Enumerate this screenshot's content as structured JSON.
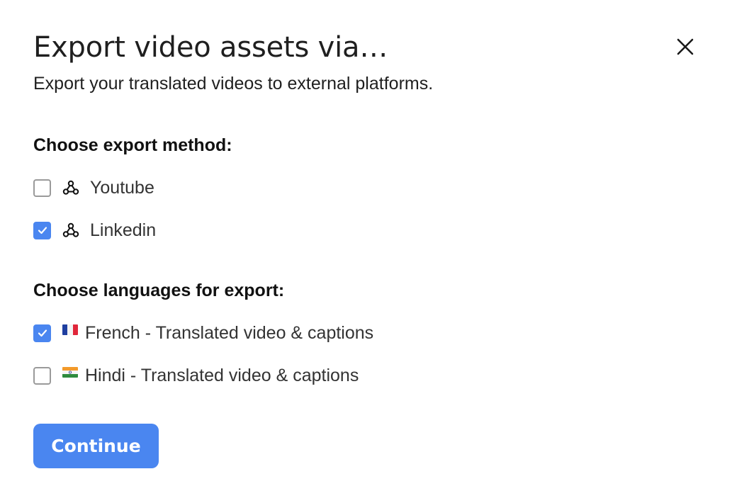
{
  "dialog": {
    "title": "Export video assets via…",
    "subtitle": "Export your translated videos to external platforms.",
    "close_icon": "close-icon"
  },
  "export_methods": {
    "heading": "Choose export method:",
    "items": [
      {
        "label": "Youtube",
        "checked": false,
        "icon": "webhook-icon"
      },
      {
        "label": "Linkedin",
        "checked": true,
        "icon": "webhook-icon"
      }
    ]
  },
  "languages": {
    "heading": "Choose languages for export:",
    "items": [
      {
        "label": "French - Translated video & captions",
        "checked": true,
        "flag": "flag-france-icon"
      },
      {
        "label": "Hindi - Translated video & captions",
        "checked": false,
        "flag": "flag-india-icon"
      }
    ]
  },
  "actions": {
    "continue_label": "Continue"
  },
  "colors": {
    "accent": "#4a86f0",
    "checkbox_border": "#9a9a9a",
    "text": "#1f1f1f"
  }
}
